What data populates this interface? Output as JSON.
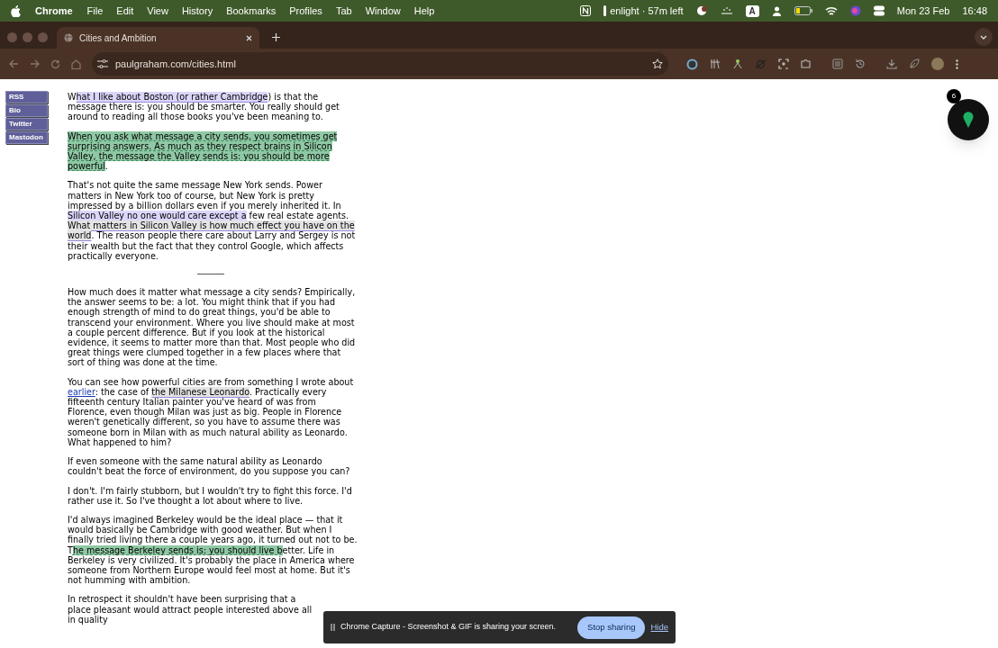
{
  "menu_bar": {
    "app": "Chrome",
    "menus": [
      "File",
      "Edit",
      "View",
      "History",
      "Bookmarks",
      "Profiles",
      "Tab",
      "Window",
      "Help"
    ],
    "status_text": "enlight · 57m left",
    "input_source": "A",
    "date": "Mon 23 Feb",
    "time": "16:48"
  },
  "tabs": [
    {
      "title": "Cities and Ambition"
    }
  ],
  "address_bar": {
    "url": "paulgraham.com/cities.html"
  },
  "sidebar_links": [
    "RSS",
    "Bio",
    "Twitter",
    "Mastodon"
  ],
  "article": [
    {
      "kind": "paragraph",
      "segments": [
        {
          "kind": "plain",
          "text": "W"
        },
        {
          "kind": "purple",
          "text": "hat I like about Boston (or rather Cambridge"
        },
        {
          "kind": "plain",
          "text": ") is that the message there is: you should be smarter. You really should get around to reading all those books you've been meaning to."
        }
      ]
    },
    {
      "kind": "paragraph",
      "segments": [
        {
          "kind": "green",
          "text": "When you ask what message a city sends, you sometimes get surprising answers. As much as they respect brains in Silicon Valley, the message the Valley sends is: you should be more powerful"
        },
        {
          "kind": "plain",
          "text": "."
        }
      ]
    },
    {
      "kind": "paragraph",
      "segments": [
        {
          "kind": "plain",
          "text": "That's not quite the same message New York sends. Power matters in New York too of course, but New York is pretty impressed by a billion dollars even if you merely inherited it. In "
        },
        {
          "kind": "purple",
          "text": "Silicon Valley no one would care except a"
        },
        {
          "kind": "plain",
          "text": " few real estate agents. "
        },
        {
          "kind": "grey",
          "text": "What matters in Silicon Valley is how much effect you have on the world"
        },
        {
          "kind": "plain",
          "text": ". The reason people there care about Larry and Sergey is not their wealth but the fact that they control Google, which affects practically everyone."
        }
      ]
    },
    {
      "kind": "divider"
    },
    {
      "kind": "paragraph",
      "segments": [
        {
          "kind": "plain",
          "text": "How much does it matter what message a city sends? Empirically, the answer seems to be: a lot. You might think that if you had enough strength of mind to do great things, you'd be able to transcend your environment. Where you live should make at most a couple percent difference. But if you look at the historical evidence, it seems to matter more than that. Most people who did great things were clumped together in a few places where that sort of thing was done at the time."
        }
      ]
    },
    {
      "kind": "paragraph",
      "segments": [
        {
          "kind": "plain",
          "text": "You can see how powerful cities are from something I wrote about "
        },
        {
          "kind": "link",
          "text": "earlier"
        },
        {
          "kind": "plain",
          "text": ": the case of "
        },
        {
          "kind": "grey",
          "text": "the Milanese Leonardo"
        },
        {
          "kind": "plain",
          "text": ". Practically every fifteenth century Italian painter you've heard of was from Florence, even though Milan was just as big. People in Florence weren't genetically different, so you have to assume there was someone born in Milan with as much natural ability as Leonardo. What happened to him?"
        }
      ]
    },
    {
      "kind": "paragraph",
      "segments": [
        {
          "kind": "plain",
          "text": "If even someone with the same natural ability as Leonardo couldn't beat the force of environment, do you suppose you can?"
        }
      ]
    },
    {
      "kind": "paragraph",
      "segments": [
        {
          "kind": "plain",
          "text": "I don't. I'm fairly stubborn, but I wouldn't try to fight this force. I'd rather use it. So I've thought a lot about where to live."
        }
      ]
    },
    {
      "kind": "paragraph",
      "segments": [
        {
          "kind": "plain",
          "text": "I'd always imagined Berkeley would be the ideal place — that it would basically be Cambridge with good weather. But when I finally tried living there a couple years ago, it turned out not to be. T"
        },
        {
          "kind": "green",
          "text": "he message Berkeley sends is: you should live b"
        },
        {
          "kind": "plain",
          "text": "etter. Life in Berkeley is very civilized. It's probably the place in America where someone from Northern Europe would feel most at home. But it's not humming with ambition."
        }
      ]
    },
    {
      "kind": "paragraph",
      "segments": [
        {
          "kind": "plain",
          "text": "In retrospect it shouldn't have been surprising that a place pleasant would attract people interested above all in quality"
        }
      ]
    }
  ],
  "extension_badge": "6",
  "sharing_bar": {
    "message": "Chrome Capture - Screenshot & GIF is sharing your screen.",
    "stop_button": "Stop sharing",
    "hide_link": "Hide"
  }
}
